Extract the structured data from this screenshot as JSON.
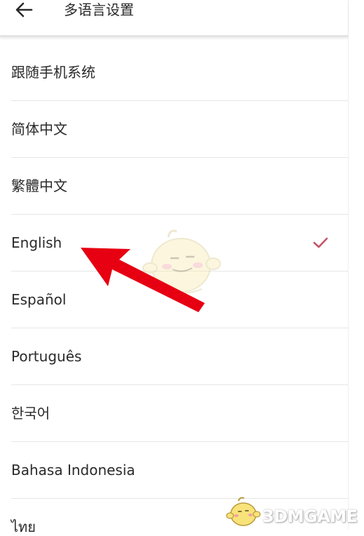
{
  "header": {
    "title": "多语言设置",
    "back_icon": "arrow-left-icon"
  },
  "languages": [
    {
      "label": "跟随手机系统",
      "selected": false
    },
    {
      "label": "简体中文",
      "selected": false
    },
    {
      "label": "繁體中文",
      "selected": false
    },
    {
      "label": "English",
      "selected": true
    },
    {
      "label": "Español",
      "selected": false
    },
    {
      "label": "Português",
      "selected": false
    },
    {
      "label": "한국어",
      "selected": false
    },
    {
      "label": "Bahasa Indonesia",
      "selected": false
    },
    {
      "label": "ไทย",
      "selected": false
    }
  ],
  "selected_check_icon": "checkmark-icon",
  "colors": {
    "check": "#c2566a",
    "arrow": "#e60012",
    "divider": "#e6e6e6",
    "text": "#2a2a2a"
  },
  "annotation": {
    "arrow_icon": "red-arrow-icon",
    "points_to": "English"
  },
  "watermark": {
    "text": "3DMGAME"
  }
}
